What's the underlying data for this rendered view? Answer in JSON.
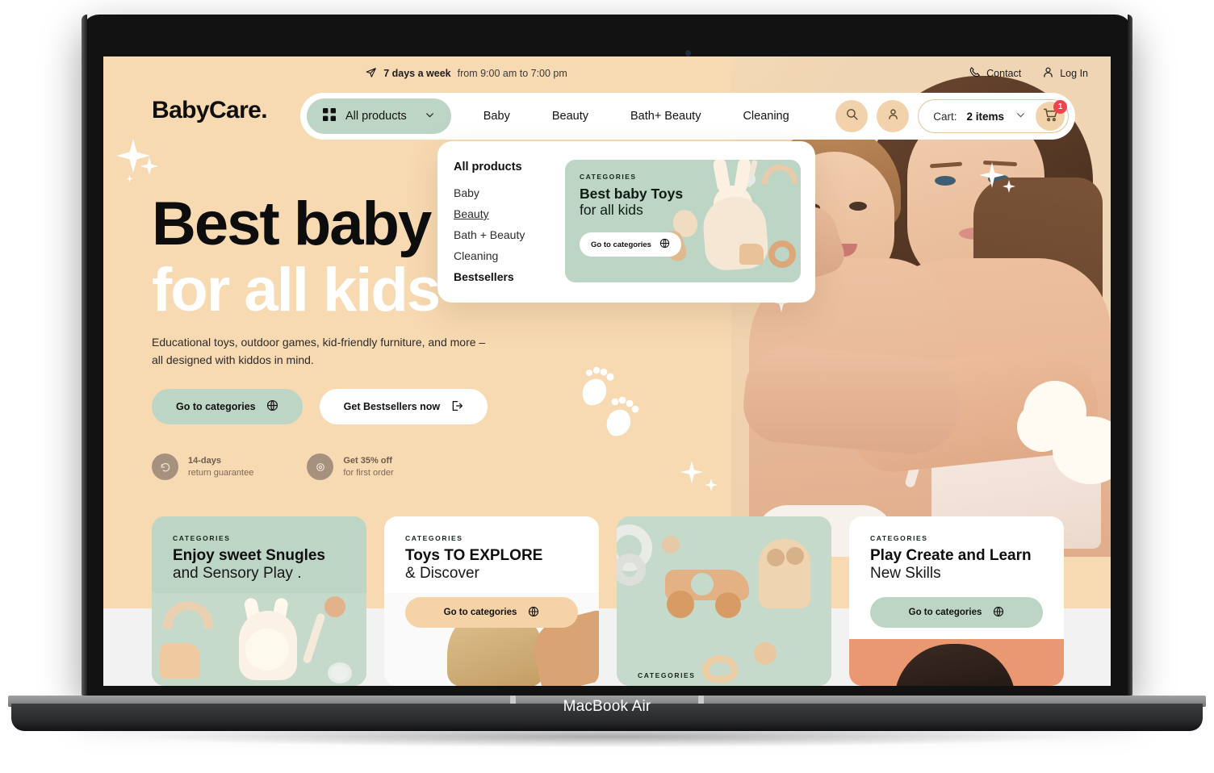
{
  "device": {
    "label": "MacBook Air"
  },
  "topbar": {
    "hours_strong": "7 days a week",
    "hours_rest": "from 9:00 am to 7:00 pm",
    "contact_label": "Contact",
    "login_label": "Log In",
    "plane_icon": "paper-plane-icon",
    "phone_icon": "phone-icon",
    "user_icon": "user-icon"
  },
  "nav": {
    "brand": "BabyCare.",
    "all_products_label": "All products",
    "grid_icon": "grid-icon",
    "chevron_icon": "chevron-down-icon",
    "links": [
      "Baby",
      "Beauty",
      "Bath+ Beauty",
      "Cleaning"
    ],
    "search_icon": "search-icon",
    "account_icon": "user-circle-icon",
    "cart_prefix": "Cart:",
    "cart_value": "2 items",
    "cart_icon": "shopping-cart-icon",
    "cart_badge": "1"
  },
  "mega_menu": {
    "title": "All products",
    "items": [
      {
        "label": "Baby",
        "style": "plain"
      },
      {
        "label": "Beauty",
        "style": "underlined"
      },
      {
        "label": "Bath + Beauty",
        "style": "plain"
      },
      {
        "label": "Cleaning",
        "style": "plain"
      },
      {
        "label": "Bestsellers",
        "style": "bold"
      }
    ],
    "promo": {
      "eyebrow": "CATEGORIES",
      "line1": "Best baby Toys",
      "line2": "for all kids",
      "button": "Go to categories",
      "button_icon": "globe-icon"
    }
  },
  "hero": {
    "line1": "Best baby",
    "line2": "for all kids",
    "description": "Educational toys, outdoor games, kid-friendly furniture, and more – all designed with kiddos in mind.",
    "primary_cta": "Go to categories",
    "primary_cta_icon": "globe-icon",
    "secondary_cta": "Get Bestsellers now",
    "secondary_cta_icon": "external-link-icon",
    "features": [
      {
        "icon": "return-icon",
        "line1": "14-days",
        "line2": "return guarantee"
      },
      {
        "icon": "discount-icon",
        "line1": "Get 35% off",
        "line2": "for first order"
      }
    ]
  },
  "cards": [
    {
      "eyebrow": "CATEGORIES",
      "line1": "Enjoy sweet Snugles",
      "line2": "and Sensory Play .",
      "button": "",
      "button_icon": ""
    },
    {
      "eyebrow": "CATEGORIES",
      "line1": "Toys TO EXPLORE",
      "line2": "& Discover",
      "button": "Go to categories",
      "button_icon": "globe-icon"
    },
    {
      "eyebrow": "CATEGORIES",
      "line1": "",
      "line2": "",
      "button": "",
      "button_icon": ""
    },
    {
      "eyebrow": "CATEGORIES",
      "line1": "Play Create and Learn",
      "line2": "New Skills",
      "button": "Go to categories",
      "button_icon": "globe-icon"
    }
  ],
  "colors": {
    "hero_bg": "#F7D9B2",
    "green": "#BDD5C4",
    "peach_button": "#F6D3A7",
    "badge_red": "#F0434E",
    "cream": "#FFFBF2"
  }
}
